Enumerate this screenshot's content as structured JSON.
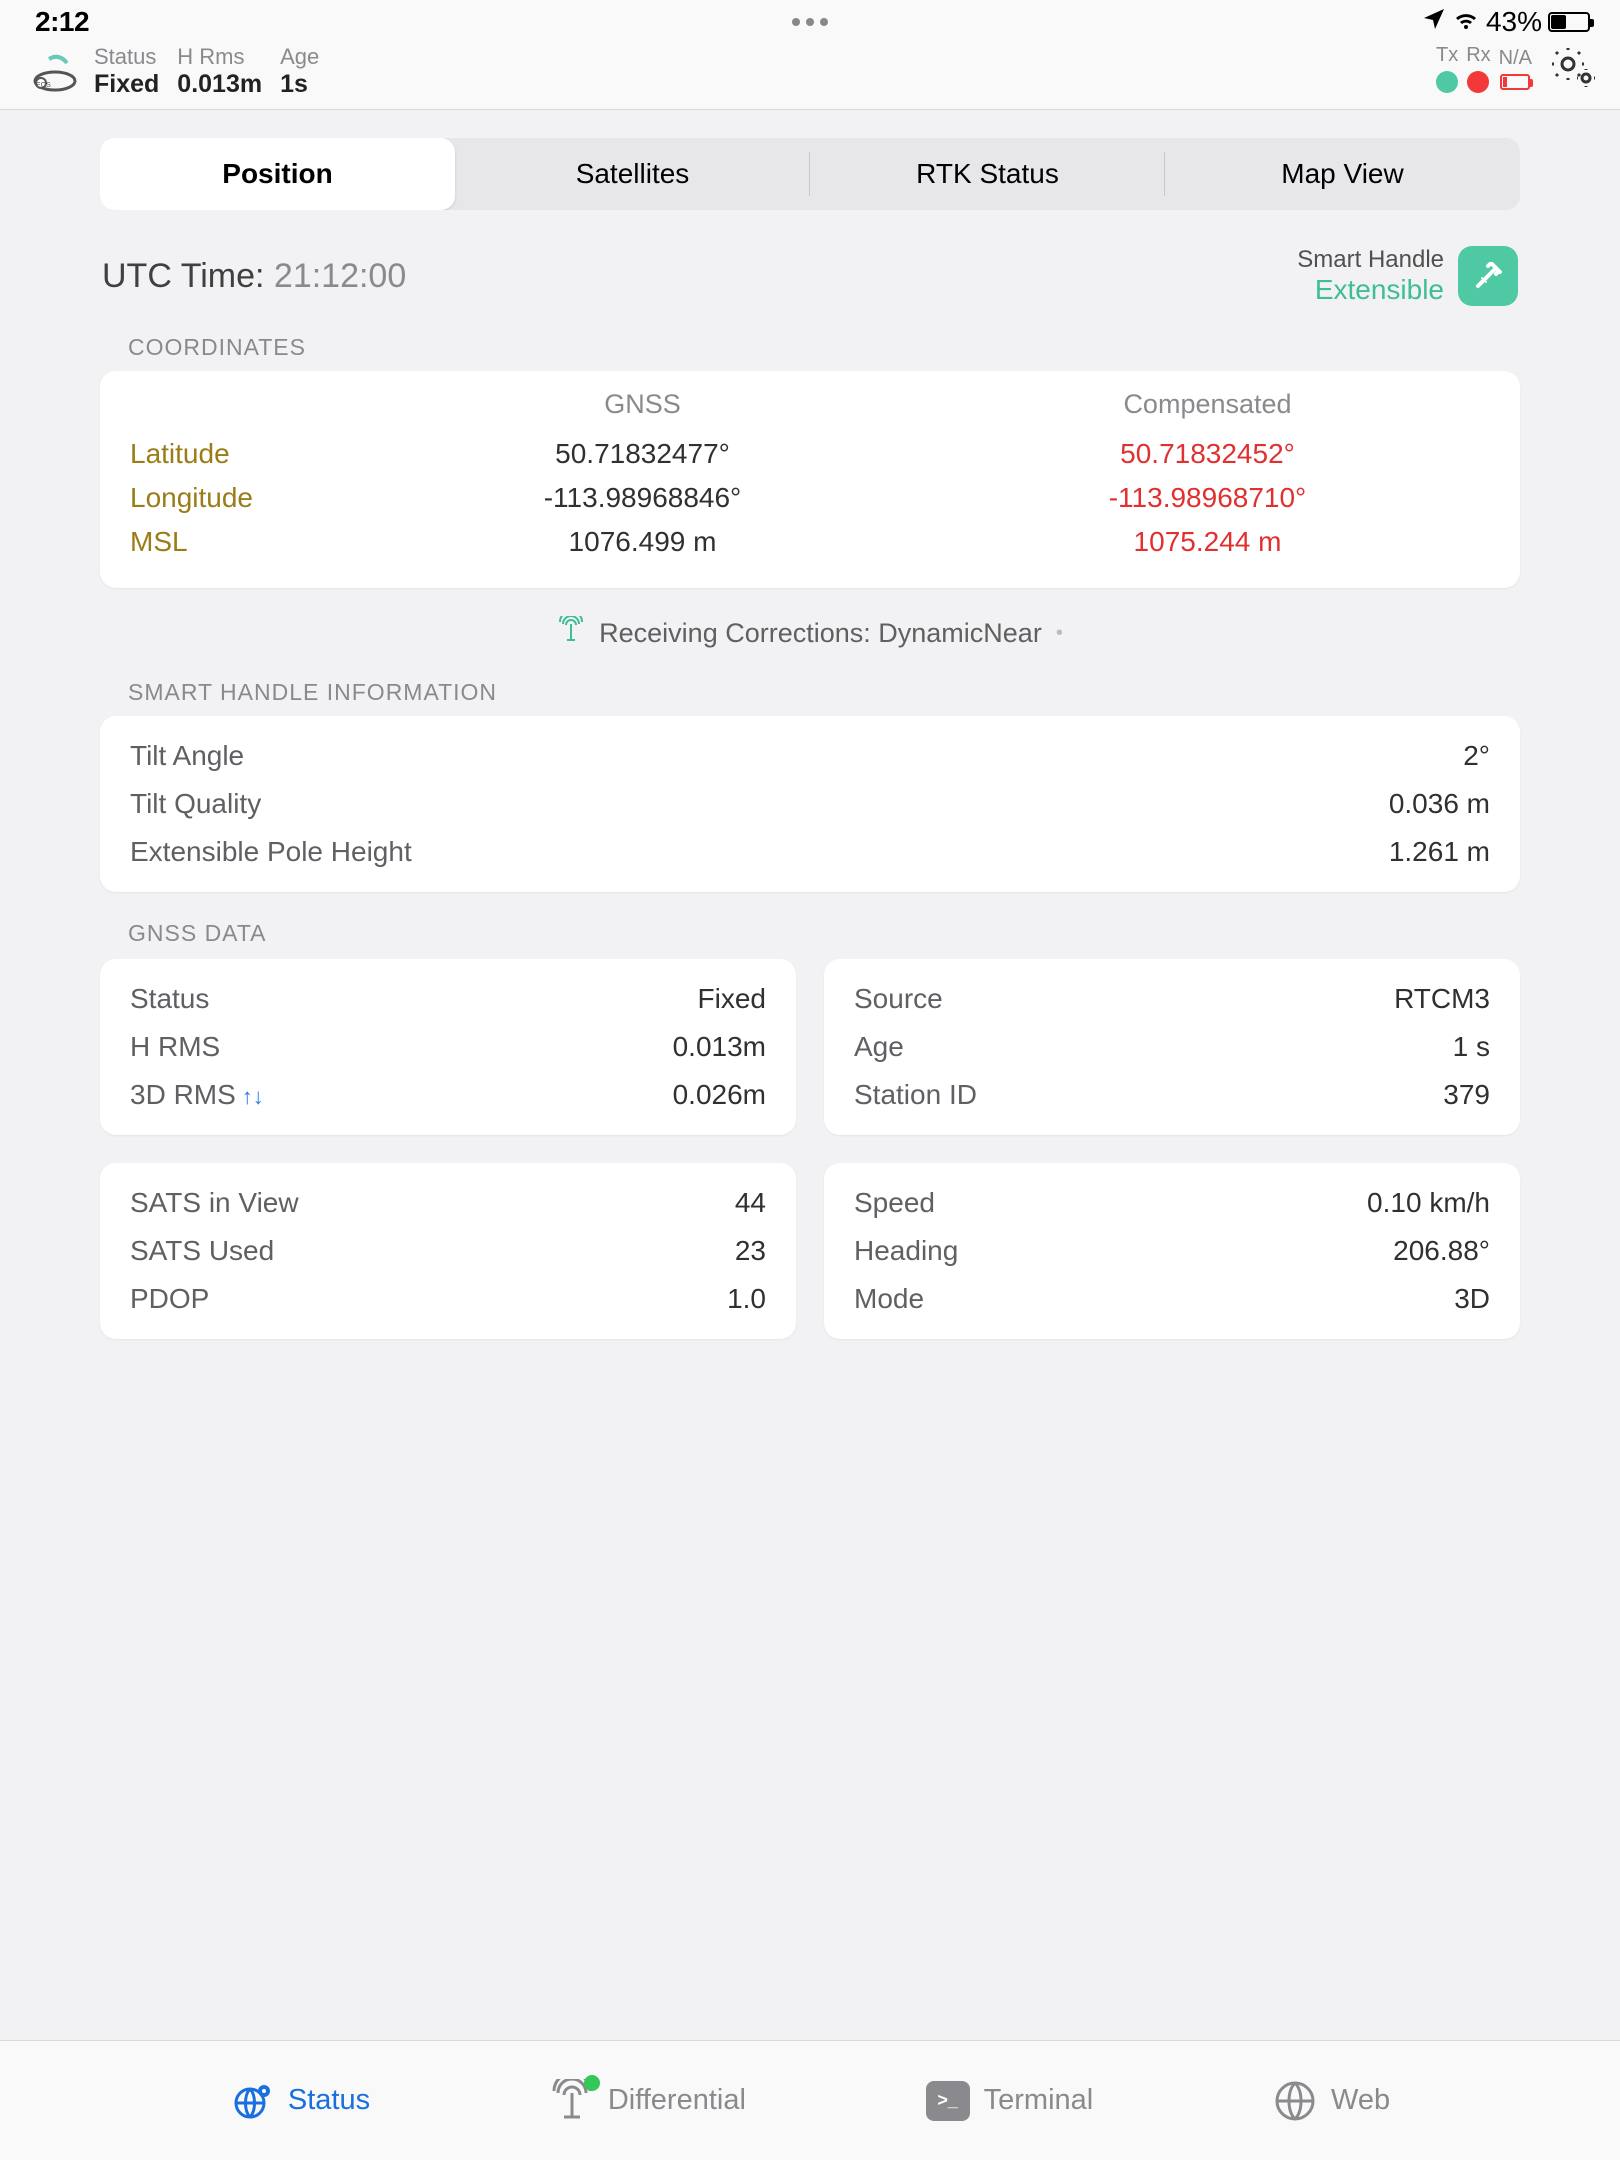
{
  "statusbar": {
    "time": "2:12",
    "battery_pct": "43%"
  },
  "header": {
    "stats": {
      "status_label": "Status",
      "status_value": "Fixed",
      "hrms_label": "H Rms",
      "hrms_value": "0.013m",
      "age_label": "Age",
      "age_value": "1s"
    },
    "indicators": {
      "tx": "Tx",
      "rx": "Rx",
      "na": "N/A"
    }
  },
  "tabs": [
    "Position",
    "Satellites",
    "RTK Status",
    "Map View"
  ],
  "utc": {
    "label": "UTC Time: ",
    "value": "21:12:00"
  },
  "smart_handle": {
    "label": "Smart Handle",
    "status": "Extensible"
  },
  "sections": {
    "coordinates_label": "COORDINATES",
    "smart_handle_label": "SMART HANDLE INFORMATION",
    "gnss_data_label": "GNSS DATA"
  },
  "coords": {
    "head_gnss": "GNSS",
    "head_comp": "Compensated",
    "rows": [
      {
        "label": "Latitude",
        "gnss": "50.71832477°",
        "comp": "50.71832452°"
      },
      {
        "label": "Longitude",
        "gnss": "-113.98968846°",
        "comp": "-113.98968710°"
      },
      {
        "label": "MSL",
        "gnss": "1076.499 m",
        "comp": "1075.244 m"
      }
    ]
  },
  "corrections": {
    "text": "Receiving Corrections: DynamicNear"
  },
  "smart_info": [
    {
      "k": "Tilt Angle",
      "v": "2°"
    },
    {
      "k": "Tilt Quality",
      "v": "0.036 m"
    },
    {
      "k": "Extensible Pole Height",
      "v": "1.261 m"
    }
  ],
  "gnss_panels": [
    [
      {
        "k": "Status",
        "v": "Fixed"
      },
      {
        "k": "H RMS",
        "v": "0.013m"
      },
      {
        "k": "3D RMS",
        "v": "0.026m",
        "updown": true
      }
    ],
    [
      {
        "k": "Source",
        "v": "RTCM3"
      },
      {
        "k": "Age",
        "v": "1 s"
      },
      {
        "k": "Station ID",
        "v": "379"
      }
    ],
    [
      {
        "k": "SATS in View",
        "v": "44"
      },
      {
        "k": "SATS Used",
        "v": "23"
      },
      {
        "k": "PDOP",
        "v": "1.0"
      }
    ],
    [
      {
        "k": "Speed",
        "v": "0.10 km/h"
      },
      {
        "k": "Heading",
        "v": "206.88°"
      },
      {
        "k": "Mode",
        "v": "3D"
      }
    ]
  ],
  "tabbar": {
    "status": "Status",
    "differential": "Differential",
    "terminal": "Terminal",
    "web": "Web"
  }
}
